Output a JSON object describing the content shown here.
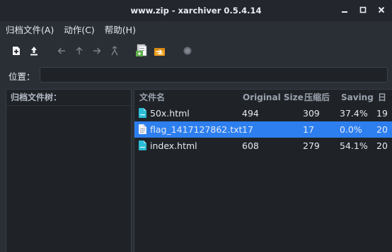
{
  "window": {
    "title": "www.zip - xarchiver 0.5.4.14",
    "controls": {
      "minimize": "_",
      "maximize": "□",
      "close": "×"
    }
  },
  "menu": [
    {
      "label": "归档文件(A)"
    },
    {
      "label": "动作(C)"
    },
    {
      "label": "帮助(H)"
    }
  ],
  "toolbar": {
    "buttons": [
      {
        "icon": "new-archive-icon"
      },
      {
        "icon": "open-archive-icon"
      },
      {
        "icon": "back-arrow-icon"
      },
      {
        "icon": "up-arrow-icon"
      },
      {
        "icon": "forward-arrow-icon"
      },
      {
        "icon": "home-icon"
      },
      {
        "icon": "add-files-icon"
      },
      {
        "icon": "extract-icon"
      },
      {
        "icon": "stop-icon"
      }
    ]
  },
  "location": {
    "label": "位置：",
    "value": ""
  },
  "tree": {
    "header": "归档文件树："
  },
  "table": {
    "columns": {
      "name": "文件名",
      "original_size": "Original Size",
      "compressed": "压缩后",
      "saving": "Saving",
      "date": "日"
    },
    "rows": [
      {
        "name": "50x.html",
        "original_size": "494",
        "compressed": "309",
        "saving": "37.4%",
        "date": "19",
        "selected": false,
        "icon": "html-file-icon"
      },
      {
        "name": "flag_1417127862.txt",
        "original_size": "17",
        "compressed": "17",
        "saving": "0.0%",
        "date": "20",
        "selected": true,
        "icon": "text-file-icon"
      },
      {
        "name": "index.html",
        "original_size": "608",
        "compressed": "279",
        "saving": "54.1%",
        "date": "20",
        "selected": false,
        "icon": "html-file-icon"
      }
    ]
  },
  "colors": {
    "window_bg": "#2a2f36",
    "titlebar_bg": "#23272d",
    "pane_bg": "#1f2328",
    "selection": "#2d7ff0",
    "html_icon": "#2bbcd6"
  }
}
